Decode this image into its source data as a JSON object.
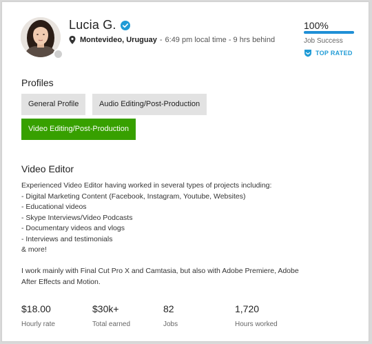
{
  "profile": {
    "name": "Lucia G.",
    "location": "Montevideo, Uruguay",
    "separator": "-",
    "local_time": "6:49 pm local time - 9 hrs behind"
  },
  "job_success": {
    "percent_text": "100%",
    "percent_value": 100,
    "label": "Job Success",
    "badge": "TOP RATED",
    "accent_color": "#1f8fd6"
  },
  "profiles_section": {
    "title": "Profiles",
    "pills": [
      {
        "label": "General Profile",
        "active": false
      },
      {
        "label": "Audio Editing/Post-Production",
        "active": false
      },
      {
        "label": "Video Editing/Post-Production",
        "active": true
      }
    ],
    "active_color": "#37a000"
  },
  "role": {
    "title": "Video Editor",
    "description_lines": [
      "Experienced Video Editor having worked in several types of projects including:",
      "- Digital Marketing Content (Facebook, Instagram, Youtube, Websites)",
      "- Educational videos",
      "- Skype Interviews/Video Podcasts",
      "- Documentary videos and vlogs",
      "- Interviews and testimonials",
      "& more!",
      "",
      "I work mainly with Final Cut Pro X and Camtasia, but also with Adobe Premiere, Adobe",
      "After Effects and Motion."
    ]
  },
  "stats": [
    {
      "value": "$18.00",
      "label": "Hourly rate"
    },
    {
      "value": "$30k+",
      "label": "Total earned"
    },
    {
      "value": "82",
      "label": "Jobs"
    },
    {
      "value": "1,720",
      "label": "Hours worked"
    }
  ],
  "icons": {
    "verified": "verified-check-icon",
    "location": "location-pin-icon",
    "top_rated": "shield-icon"
  }
}
